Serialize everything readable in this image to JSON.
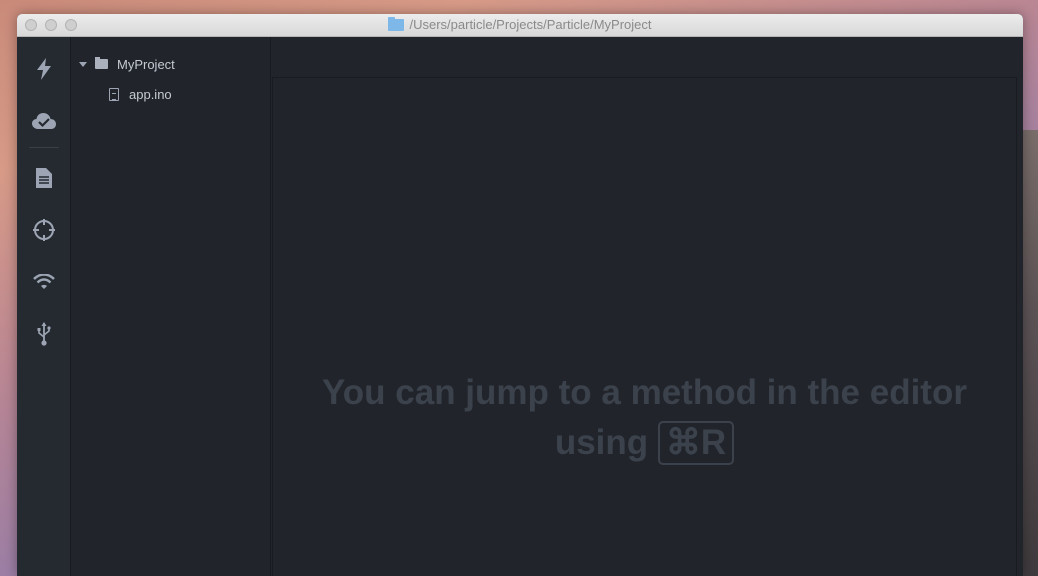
{
  "window": {
    "title": "/Users/particle/Projects/Particle/MyProject"
  },
  "toolbar": {
    "items": [
      {
        "icon": "flash-icon"
      },
      {
        "icon": "cloud-check-icon"
      },
      {
        "icon": "document-icon"
      },
      {
        "icon": "crosshair-icon"
      },
      {
        "icon": "wifi-icon"
      },
      {
        "icon": "usb-icon"
      }
    ]
  },
  "tree": {
    "root": {
      "label": "MyProject"
    },
    "files": [
      {
        "label": "app.ino"
      }
    ]
  },
  "editor": {
    "hint_line1": "You can jump to a method in the editor",
    "hint_line2_prefix": "using",
    "hint_shortcut": "⌘R"
  }
}
